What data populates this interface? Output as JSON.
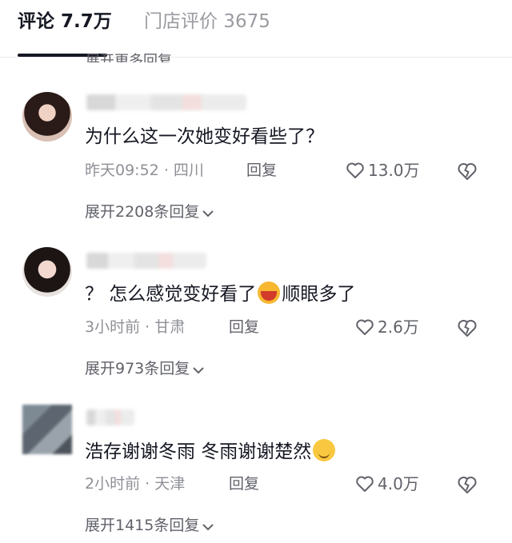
{
  "tabs": [
    {
      "label": "评论 7.7万"
    },
    {
      "label": "门店评价 3675"
    }
  ],
  "top_expand": "展开更多回复",
  "comments": [
    {
      "text": "为什么这一次她变好看些了？",
      "time": "昨天09:52",
      "location": "四川",
      "reply_label": "回复",
      "likes": "13.0万",
      "expand_replies": "展开2208条回复"
    },
    {
      "text_before": "？ 怎么感觉变好看了",
      "emoji": "laugh-emoji",
      "text_after": "顺眼多了",
      "time": "3小时前",
      "location": "甘肃",
      "reply_label": "回复",
      "likes": "2.6万",
      "expand_replies": "展开973条回复"
    },
    {
      "text_before": "浩存谢谢冬雨 冬雨谢谢楚然",
      "emoji": "smile-emoji",
      "time": "2小时前",
      "location": "天津",
      "reply_label": "回复",
      "likes": "4.0万",
      "expand_replies": "展开1415条回复"
    }
  ],
  "icons": {
    "like": "heart-outline-icon",
    "dislike": "broken-heart-icon",
    "expand": "chevron-down-icon"
  },
  "colors": {
    "primary_text": "#161823",
    "secondary_text": "#61626a",
    "meta_text": "#8f9097",
    "inactive_tab": "#9a9ba1"
  }
}
